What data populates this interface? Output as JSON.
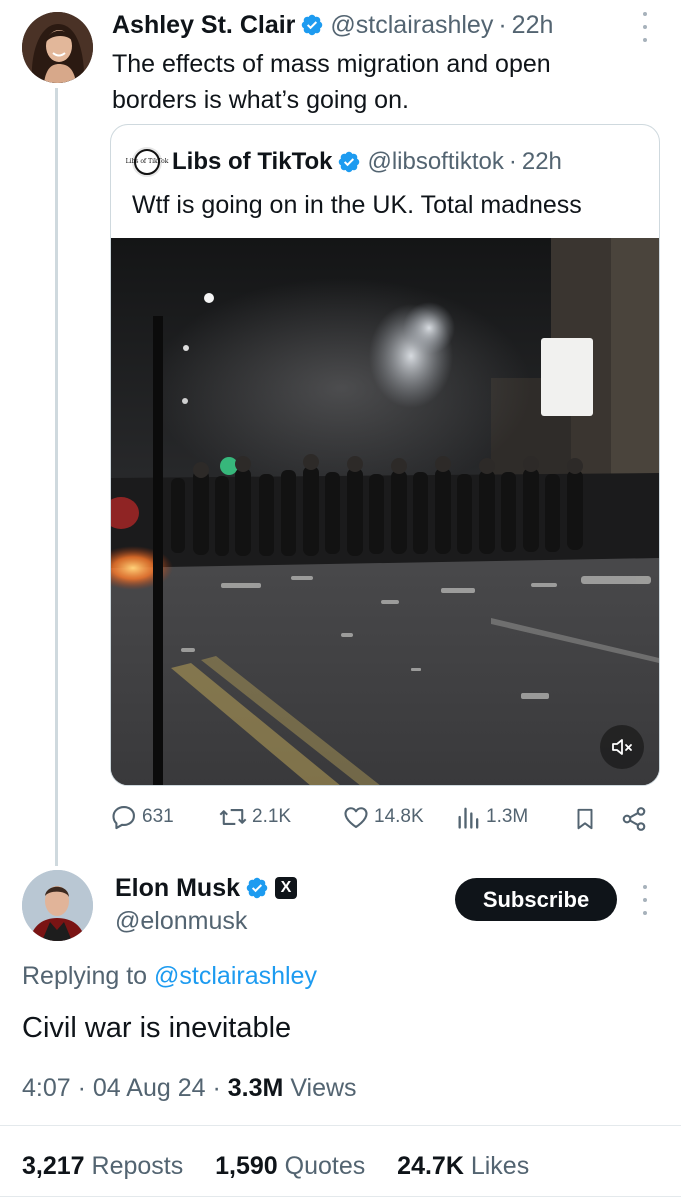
{
  "tweet": {
    "author_name": "Ashley St. Clair",
    "handle": "@stclairashley",
    "time": "22h",
    "text": "The effects of mass migration and open borders is what’s going on.",
    "quote": {
      "author_name": "Libs of TikTok",
      "handle": "@libsoftiktok",
      "time": "22h",
      "text": "Wtf is going on in the UK. Total madness",
      "avatar_text": "Libs of TikTok"
    },
    "actions": {
      "replies": "631",
      "reposts": "2.1K",
      "likes": "14.8K",
      "views": "1.3M"
    }
  },
  "reply": {
    "author_name": "Elon Musk",
    "handle": "@elonmusk",
    "badge_glyph": "X",
    "subscribe_label": "Subscribe",
    "replying_prefix": "Replying to",
    "replying_handle": "@stclairashley",
    "text": "Civil war is inevitable",
    "time": "4:07",
    "date": "04 Aug 24",
    "views_count": "3.3M",
    "views_label": "Views",
    "reposts_count": "3,217",
    "reposts_label": "Reposts",
    "quotes_count": "1,590",
    "quotes_label": "Quotes",
    "likes_count": "24.7K",
    "likes_label": "Likes"
  },
  "icons": {
    "verified": "verified-badge-icon",
    "reply": "reply-icon",
    "repost": "repost-icon",
    "like": "heart-icon",
    "views": "views-icon",
    "bookmark": "bookmark-icon",
    "share": "share-icon",
    "mute": "muted-speaker-icon",
    "more": "more-dots-icon"
  },
  "colors": {
    "text_primary": "#0f1419",
    "text_secondary": "#536471",
    "link": "#1d9bf0",
    "verified": "#1d9bf0",
    "button_bg": "#0f1419"
  }
}
